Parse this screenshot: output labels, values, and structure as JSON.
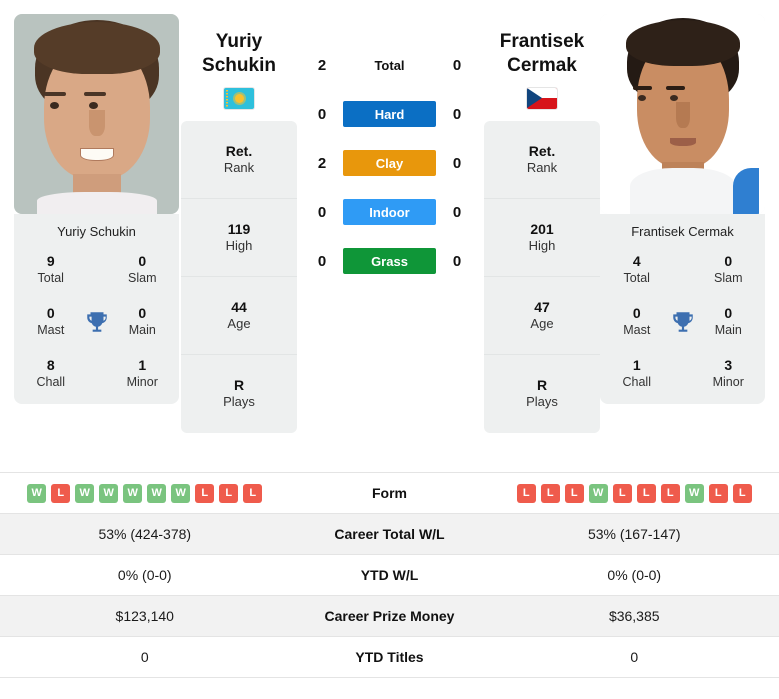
{
  "players": {
    "left": {
      "first_name": "Yuriy",
      "last_name": "Schukin",
      "full_name": "Yuriy Schukin",
      "flag": "kazakhstan-flag",
      "photo": "player-photo-yuriy-schukin",
      "info": [
        {
          "value": "Ret.",
          "label": "Rank"
        },
        {
          "value": "119",
          "label": "High"
        },
        {
          "value": "44",
          "label": "Age"
        },
        {
          "value": "R",
          "label": "Plays"
        }
      ],
      "titles": {
        "total": "9",
        "slam": "0",
        "mast": "0",
        "main": "0",
        "chall": "8",
        "minor": "1"
      },
      "form": [
        "W",
        "L",
        "W",
        "W",
        "W",
        "W",
        "W",
        "L",
        "L",
        "L"
      ],
      "career_total_wl": "53% (424-378)",
      "ytd_wl": "0% (0-0)",
      "career_prize_money": "$123,140",
      "ytd_titles": "0"
    },
    "right": {
      "first_name": "Frantisek",
      "last_name": "Cermak",
      "full_name": "Frantisek Cermak",
      "flag": "czech-republic-flag",
      "photo": "player-photo-frantisek-cermak",
      "info": [
        {
          "value": "Ret.",
          "label": "Rank"
        },
        {
          "value": "201",
          "label": "High"
        },
        {
          "value": "47",
          "label": "Age"
        },
        {
          "value": "R",
          "label": "Plays"
        }
      ],
      "titles": {
        "total": "4",
        "slam": "0",
        "mast": "0",
        "main": "0",
        "chall": "1",
        "minor": "3"
      },
      "form": [
        "L",
        "L",
        "L",
        "W",
        "L",
        "L",
        "L",
        "W",
        "L",
        "L"
      ],
      "career_total_wl": "53% (167-147)",
      "ytd_wl": "0% (0-0)",
      "career_prize_money": "$36,385",
      "ytd_titles": "0"
    }
  },
  "labels": {
    "total_titles": "Total",
    "slam": "Slam",
    "mast": "Mast",
    "main": "Main",
    "chall": "Chall",
    "minor": "Minor",
    "trophy_icon": "trophy-icon"
  },
  "head_to_head": [
    {
      "surface": "Total",
      "left": "2",
      "right": "0",
      "color": "",
      "plain": true
    },
    {
      "surface": "Hard",
      "left": "0",
      "right": "0",
      "color": "#0b6fc4",
      "plain": false
    },
    {
      "surface": "Clay",
      "left": "2",
      "right": "0",
      "color": "#e8970c",
      "plain": false
    },
    {
      "surface": "Indoor",
      "left": "0",
      "right": "0",
      "color": "#2f9bf5",
      "plain": false
    },
    {
      "surface": "Grass",
      "left": "0",
      "right": "0",
      "color": "#0f9638",
      "plain": false
    }
  ],
  "stats_table": [
    {
      "label": "Form",
      "left": "",
      "right": "",
      "type": "form",
      "shaded": false
    },
    {
      "label": "Career Total W/L",
      "left": "53% (424-378)",
      "right": "53% (167-147)",
      "type": "text",
      "shaded": true
    },
    {
      "label": "YTD W/L",
      "left": "0% (0-0)",
      "right": "0% (0-0)",
      "type": "text",
      "shaded": false
    },
    {
      "label": "Career Prize Money",
      "left": "$123,140",
      "right": "$36,385",
      "type": "text",
      "shaded": true
    },
    {
      "label": "YTD Titles",
      "left": "0",
      "right": "0",
      "type": "text",
      "shaded": false
    }
  ],
  "colors": {
    "hard": "#0b6fc4",
    "clay": "#e8970c",
    "indoor": "#2f9bf5",
    "grass": "#0f9638",
    "win_badge": "#7ac47f",
    "loss_badge": "#ef5b4c",
    "card_bg": "#eef0f0",
    "trophy": "#3d6fb0"
  }
}
